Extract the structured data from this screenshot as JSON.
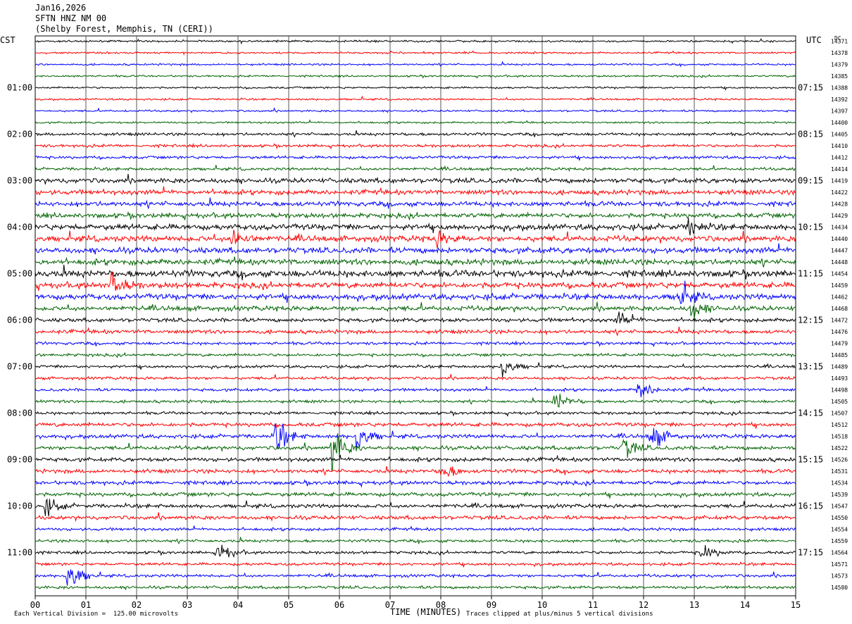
{
  "header": {
    "date": "Jan16,2026",
    "station": "SFTN HNZ NM 00",
    "location": "(Shelby Forest, Memphis, TN (CERI))"
  },
  "chart_data": {
    "type": "line",
    "title": "SFTN HNZ NM 00",
    "left_tz": "CST",
    "right_tz": "UTC",
    "dc_label": "DC",
    "xlabel": "TIME (MINUTES)",
    "xlim": [
      0,
      15
    ],
    "x_ticks": [
      "00",
      "01",
      "02",
      "03",
      "04",
      "05",
      "06",
      "07",
      "08",
      "09",
      "10",
      "11",
      "12",
      "13",
      "14",
      "15"
    ],
    "trace_colors": [
      "#000000",
      "#ff0000",
      "#0000ff",
      "#006400"
    ],
    "left_time_labels": [
      "01:00",
      "02:00",
      "03:00",
      "04:00",
      "05:00",
      "06:00",
      "07:00",
      "08:00",
      "09:00",
      "10:00",
      "11:00"
    ],
    "right_time_labels": [
      "07:15",
      "08:15",
      "09:15",
      "10:15",
      "11:15",
      "12:15",
      "13:15",
      "14:15",
      "15:15",
      "16:15",
      "17:15"
    ],
    "dc_offsets": [
      14371,
      14378,
      14379,
      14385,
      14388,
      14392,
      14397,
      14400,
      14405,
      14410,
      14412,
      14414,
      14419,
      14422,
      14428,
      14429,
      14434,
      14440,
      14447,
      14448,
      14454,
      14459,
      14462,
      14468,
      14472,
      14476,
      14479,
      14485,
      14489,
      14493,
      14498,
      14505,
      14507,
      14512,
      14518,
      14522,
      14526,
      14531,
      14534,
      14539,
      14547,
      14550,
      14554,
      14559,
      14564,
      14571,
      14573,
      14580
    ],
    "trace_activity": [
      1,
      1,
      1,
      1,
      1,
      1,
      1,
      1,
      1.5,
      1.5,
      1.5,
      1.5,
      2.5,
      2.5,
      2.5,
      2.5,
      3,
      3,
      3,
      3,
      3.5,
      3,
      3,
      2.5,
      2,
      2,
      1.5,
      1.5,
      1.5,
      1.5,
      1.5,
      1.5,
      1.5,
      2,
      2,
      2,
      2,
      2,
      2,
      2,
      2,
      2,
      1.5,
      1.5,
      1.5,
      1.5,
      1.5,
      1.5
    ],
    "events": [
      {
        "trace": 17,
        "minute": 3.9,
        "amp": 2.5
      },
      {
        "trace": 17,
        "minute": 7.9,
        "amp": 1.8
      },
      {
        "trace": 16,
        "minute": 12.9,
        "amp": 2.0
      },
      {
        "trace": 21,
        "minute": 1.5,
        "amp": 3.0
      },
      {
        "trace": 22,
        "minute": 12.7,
        "amp": 3.0
      },
      {
        "trace": 23,
        "minute": 12.95,
        "amp": 2.5
      },
      {
        "trace": 24,
        "minute": 11.5,
        "amp": 1.5
      },
      {
        "trace": 28,
        "minute": 9.2,
        "amp": 2.5
      },
      {
        "trace": 30,
        "minute": 11.9,
        "amp": 2.5
      },
      {
        "trace": 31,
        "minute": 10.25,
        "amp": 2.5
      },
      {
        "trace": 34,
        "minute": 4.75,
        "amp": 4.0
      },
      {
        "trace": 34,
        "minute": 6.35,
        "amp": 3.5
      },
      {
        "trace": 34,
        "minute": 12.15,
        "amp": 3.5
      },
      {
        "trace": 35,
        "minute": 5.85,
        "amp": 5.0
      },
      {
        "trace": 35,
        "minute": 11.6,
        "amp": 2.5
      },
      {
        "trace": 37,
        "minute": 8.0,
        "amp": 2.5
      },
      {
        "trace": 40,
        "minute": 0.2,
        "amp": 2.0
      },
      {
        "trace": 44,
        "minute": 3.6,
        "amp": 2.5
      },
      {
        "trace": 44,
        "minute": 13.15,
        "amp": 2.0
      },
      {
        "trace": 46,
        "minute": 0.65,
        "amp": 4.0
      }
    ]
  },
  "footer": {
    "left_note": "Each Vertical Division =  125.00 microvolts",
    "right_note": "Traces clipped at plus/minus 5 vertical divisions"
  }
}
